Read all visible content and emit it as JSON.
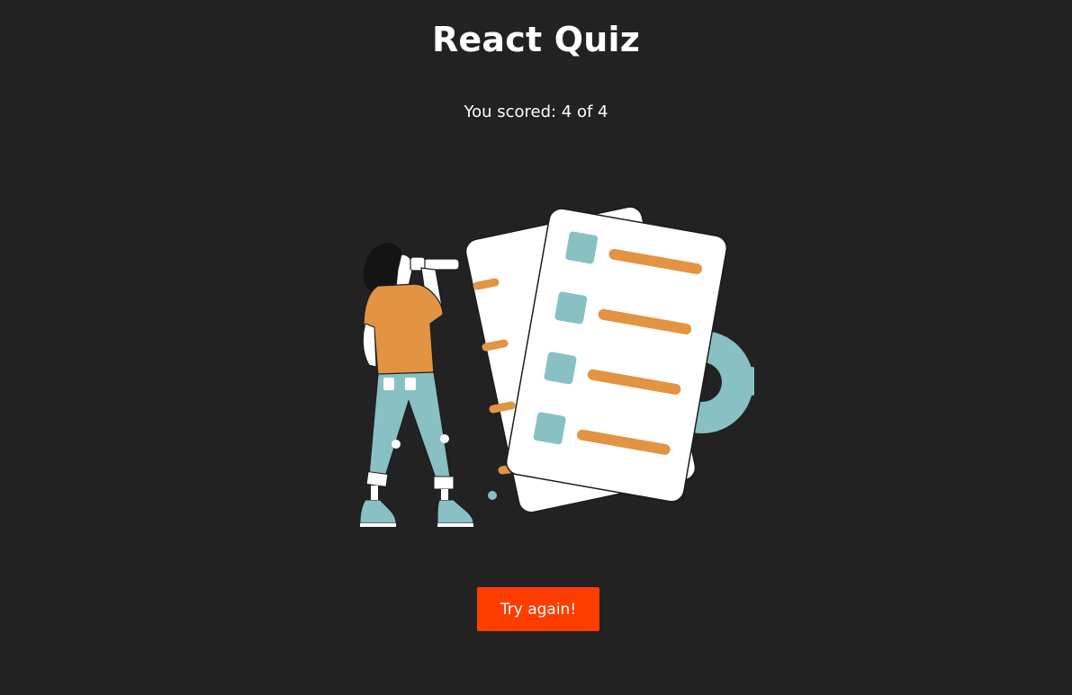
{
  "app": {
    "title": "React Quiz"
  },
  "result": {
    "score_text": "You scored: 4 of 4",
    "score": 4,
    "total": 4
  },
  "actions": {
    "try_again_label": "Try again!"
  },
  "illustration": {
    "icon": "quiz-checklist-illustration",
    "colors": {
      "paper": "#ffffff",
      "teal": "#88c0c3",
      "orange": "#e29442",
      "outline": "#1b1b1b",
      "hair": "#141414"
    }
  },
  "colors": {
    "background": "#222222",
    "text": "#ffffff",
    "button": "#ff3d00"
  }
}
